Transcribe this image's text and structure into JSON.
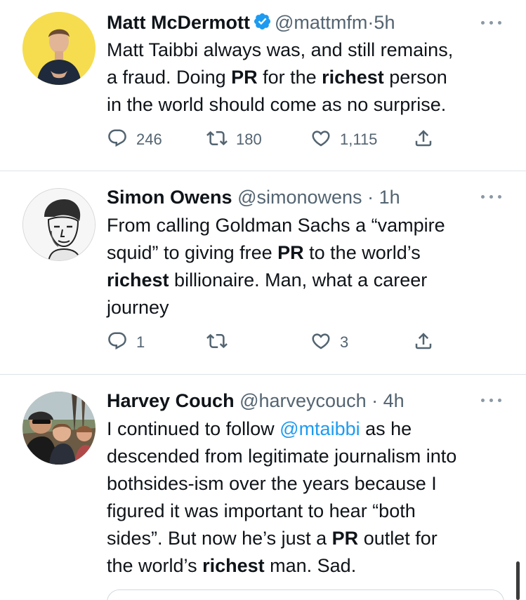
{
  "tweets": [
    {
      "name": "Matt McDermott",
      "handle": "@mattmfm",
      "sep": "·",
      "time": "5h",
      "verified": true,
      "body": [
        [
          {
            "t": "Matt Taibbi always was, and still remains,"
          }
        ],
        [
          {
            "t": "a fraud. Doing "
          },
          {
            "t": "PR",
            "b": true
          },
          {
            "t": " for the "
          },
          {
            "t": "richest",
            "b": true
          },
          {
            "t": " person"
          }
        ],
        [
          {
            "t": "in the world should come as no surprise."
          }
        ]
      ],
      "replies": "246",
      "retweets": "180",
      "likes": "1,115"
    },
    {
      "name": "Simon Owens",
      "handle": "@simonowens",
      "sep": "·",
      "time": "1h",
      "verified": false,
      "body": [
        [
          {
            "t": "From calling Goldman Sachs a “vampire"
          }
        ],
        [
          {
            "t": "squid” to giving free "
          },
          {
            "t": "PR",
            "b": true
          },
          {
            "t": " to the world’s"
          }
        ],
        [
          {
            "t": "richest",
            "b": true
          },
          {
            "t": " billionaire. Man, what a career"
          }
        ],
        [
          {
            "t": "journey"
          }
        ]
      ],
      "replies": "1",
      "retweets": "",
      "likes": "3"
    },
    {
      "name": "Harvey Couch",
      "handle": "@harveycouch",
      "sep": "·",
      "time": "4h",
      "verified": false,
      "body": [
        [
          {
            "t": "I continued to follow "
          },
          {
            "t": "@mtaibbi",
            "m": true
          },
          {
            "t": " as he"
          }
        ],
        [
          {
            "t": "descended from legitimate journalism into"
          }
        ],
        [
          {
            "t": "bothsides-ism over the years because I"
          }
        ],
        [
          {
            "t": "figured it was important to hear “both"
          }
        ],
        [
          {
            "t": "sides”. But now he’s just a "
          },
          {
            "t": "PR",
            "b": true
          },
          {
            "t": " outlet for"
          }
        ],
        [
          {
            "t": "the world’s "
          },
          {
            "t": "richest",
            "b": true
          },
          {
            "t": " man. Sad."
          }
        ]
      ]
    }
  ],
  "icons": {
    "reply": "reply-icon",
    "retweet": "retweet-icon",
    "like": "like-icon",
    "share": "share-icon",
    "more": "more-icon",
    "verified": "verified-badge-icon"
  },
  "colors": {
    "text": "#0f1419",
    "secondary": "#536471",
    "mention": "#1d9bf0",
    "verified": "#1d9bf0",
    "divider": "#dfe3e6",
    "avatar1_bg": "#f5dd4f"
  }
}
